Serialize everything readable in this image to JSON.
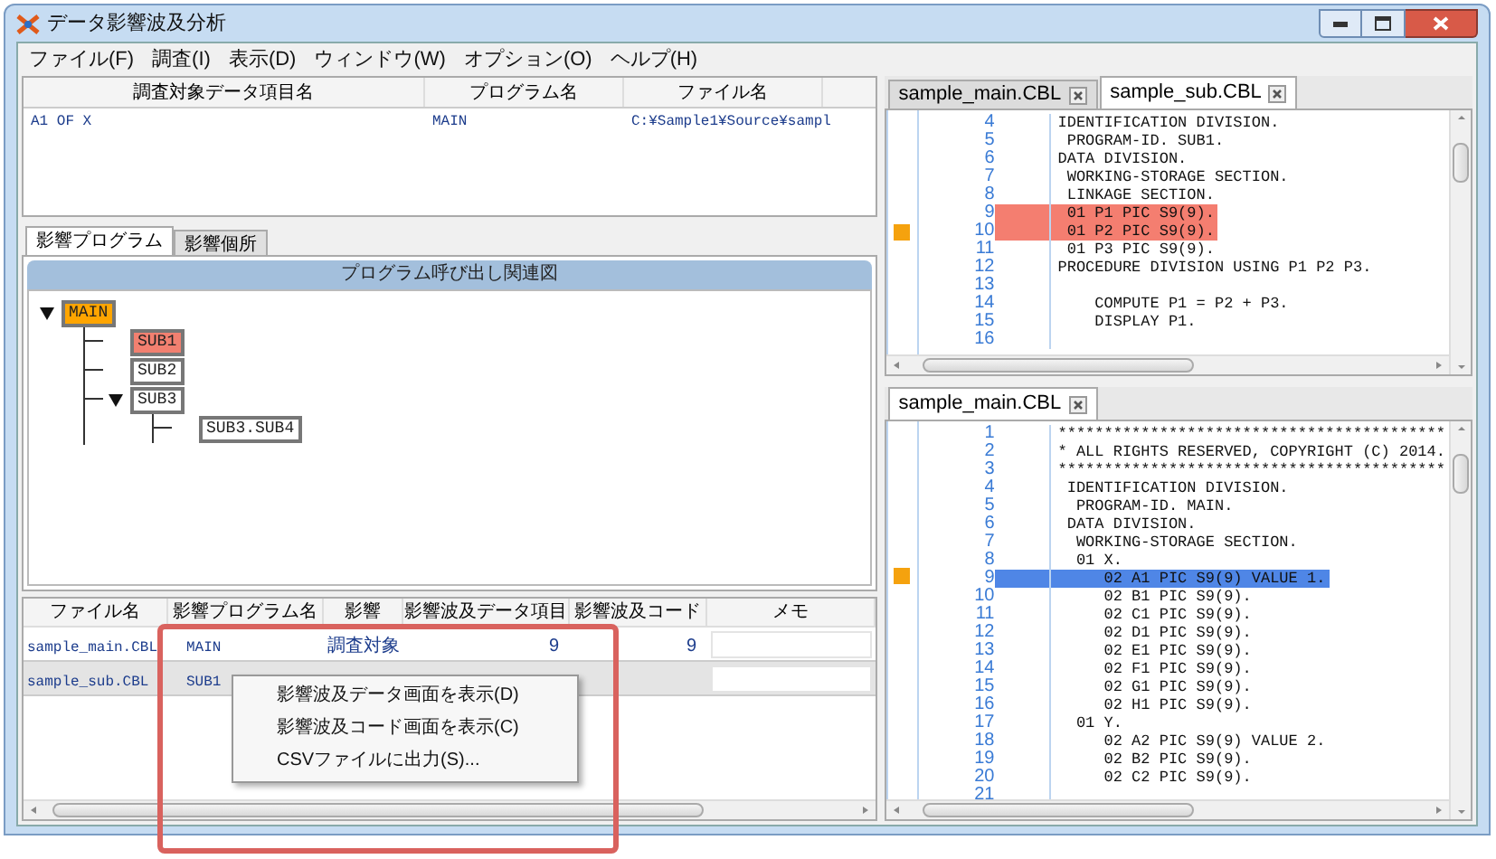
{
  "window": {
    "title": "データ影響波及分析"
  },
  "menu": [
    "ファイル(F)",
    "調査(I)",
    "表示(D)",
    "ウィンドウ(W)",
    "オプション(O)",
    "ヘルプ(H)"
  ],
  "target_table": {
    "columns": [
      "調査対象データ項目名",
      "プログラム名",
      "ファイル名"
    ],
    "rows": [
      {
        "cells": [
          "A1 OF X",
          "MAIN",
          "C:¥Sample1¥Source¥sampl"
        ]
      }
    ]
  },
  "tabs": [
    {
      "label": "影響プログラム",
      "selected": true
    },
    {
      "label": "影響個所",
      "selected": false
    }
  ],
  "diagram": {
    "title": "プログラム呼び出し関連図",
    "nodes": [
      {
        "label": "MAIN",
        "color": "#ffa500",
        "expanded": true,
        "children": [
          {
            "label": "SUB1",
            "color": "#f28070"
          },
          {
            "label": "SUB2",
            "color": "#ffffff"
          },
          {
            "label": "SUB3",
            "color": "#ffffff",
            "expanded": true,
            "children": [
              {
                "label": "SUB3.SUB4",
                "color": "#ffffff"
              }
            ]
          }
        ]
      }
    ]
  },
  "impact_table": {
    "columns": [
      "ファイル名",
      "影響プログラム名",
      "影響",
      "影響波及データ項目",
      "影響波及コード",
      "メモ"
    ],
    "rows": [
      {
        "selected": false,
        "file": "sample_main.CBL",
        "program": "MAIN",
        "impact": "調査対象",
        "data_items": "9",
        "code": "9"
      },
      {
        "selected": true,
        "file": "sample_sub.CBL",
        "program": "SUB1"
      }
    ]
  },
  "context_menu": [
    "影響波及データ画面を表示(D)",
    "影響波及コード画面を表示(C)",
    "CSVファイルに出力(S)..."
  ],
  "editors": [
    {
      "color": "#f47e70",
      "tabs": [
        {
          "label": "sample_main.CBL",
          "selected": false
        },
        {
          "label": "sample_sub.CBL",
          "selected": true
        }
      ],
      "lines": [
        {
          "no": "4",
          "text": "IDENTIFICATION DIVISION.",
          "highlighted": false,
          "marker": false
        },
        {
          "no": "5",
          "text": " PROGRAM-ID. SUB1.",
          "highlighted": false,
          "marker": false
        },
        {
          "no": "6",
          "text": "DATA DIVISION.",
          "highlighted": false,
          "marker": false
        },
        {
          "no": "7",
          "text": " WORKING-STORAGE SECTION.",
          "highlighted": false,
          "marker": false
        },
        {
          "no": "8",
          "text": " LINKAGE SECTION.",
          "highlighted": false,
          "marker": false
        },
        {
          "no": "9",
          "text": " 01 P1 PIC S9(9).",
          "highlighted": true,
          "marker": false
        },
        {
          "no": "10",
          "text": " 01 P2 PIC S9(9).",
          "highlighted": true,
          "marker": true
        },
        {
          "no": "11",
          "text": " 01 P3 PIC S9(9).",
          "highlighted": false,
          "marker": false
        },
        {
          "no": "12",
          "text": "PROCEDURE DIVISION USING P1 P2 P3.",
          "highlighted": false,
          "marker": false
        },
        {
          "no": "13",
          "highlighted": false,
          "marker": false
        },
        {
          "no": "14",
          "text": "    COMPUTE P1 = P2 + P3.",
          "highlighted": false,
          "marker": false
        },
        {
          "no": "15",
          "text": "    DISPLAY P1.",
          "highlighted": false,
          "marker": false
        },
        {
          "no": "16",
          "highlighted": false,
          "marker": false
        }
      ]
    },
    {
      "color": "#4f86e6",
      "tabs": [
        {
          "label": "sample_main.CBL",
          "selected": true
        }
      ],
      "lines": [
        {
          "no": "1",
          "text": "******************************************",
          "highlighted": false,
          "marker": false
        },
        {
          "no": "2",
          "text": "* ALL RIGHTS RESERVED, COPYRIGHT (C) 2014.",
          "highlighted": false,
          "marker": false
        },
        {
          "no": "3",
          "text": "******************************************",
          "highlighted": false,
          "marker": false
        },
        {
          "no": "4",
          "text": " IDENTIFICATION DIVISION.",
          "highlighted": false,
          "marker": false
        },
        {
          "no": "5",
          "text": "  PROGRAM-ID. MAIN.",
          "highlighted": false,
          "marker": false
        },
        {
          "no": "6",
          "text": " DATA DIVISION.",
          "highlighted": false,
          "marker": false
        },
        {
          "no": "7",
          "text": "  WORKING-STORAGE SECTION.",
          "highlighted": false,
          "marker": false
        },
        {
          "no": "8",
          "text": "  01 X.",
          "highlighted": false,
          "marker": false
        },
        {
          "no": "9",
          "text": "     02 A1 PIC S9(9) VALUE 1.",
          "highlighted": true,
          "marker": true
        },
        {
          "no": "10",
          "text": "     02 B1 PIC S9(9).",
          "highlighted": false,
          "marker": false
        },
        {
          "no": "11",
          "text": "     02 C1 PIC S9(9).",
          "highlighted": false,
          "marker": false
        },
        {
          "no": "12",
          "text": "     02 D1 PIC S9(9).",
          "highlighted": false,
          "marker": false
        },
        {
          "no": "13",
          "text": "     02 E1 PIC S9(9).",
          "highlighted": false,
          "marker": false
        },
        {
          "no": "14",
          "text": "     02 F1 PIC S9(9).",
          "highlighted": false,
          "marker": false
        },
        {
          "no": "15",
          "text": "     02 G1 PIC S9(9).",
          "highlighted": false,
          "marker": false
        },
        {
          "no": "16",
          "text": "     02 H1 PIC S9(9).",
          "highlighted": false,
          "marker": false
        },
        {
          "no": "17",
          "text": "  01 Y.",
          "highlighted": false,
          "marker": false
        },
        {
          "no": "18",
          "text": "     02 A2 PIC S9(9) VALUE 2.",
          "highlighted": false,
          "marker": false
        },
        {
          "no": "19",
          "text": "     02 B2 PIC S9(9).",
          "highlighted": false,
          "marker": false
        },
        {
          "no": "20",
          "text": "     02 C2 PIC S9(9).",
          "highlighted": false,
          "marker": false
        },
        {
          "no": "21",
          "highlighted": false,
          "marker": false
        }
      ]
    }
  ]
}
